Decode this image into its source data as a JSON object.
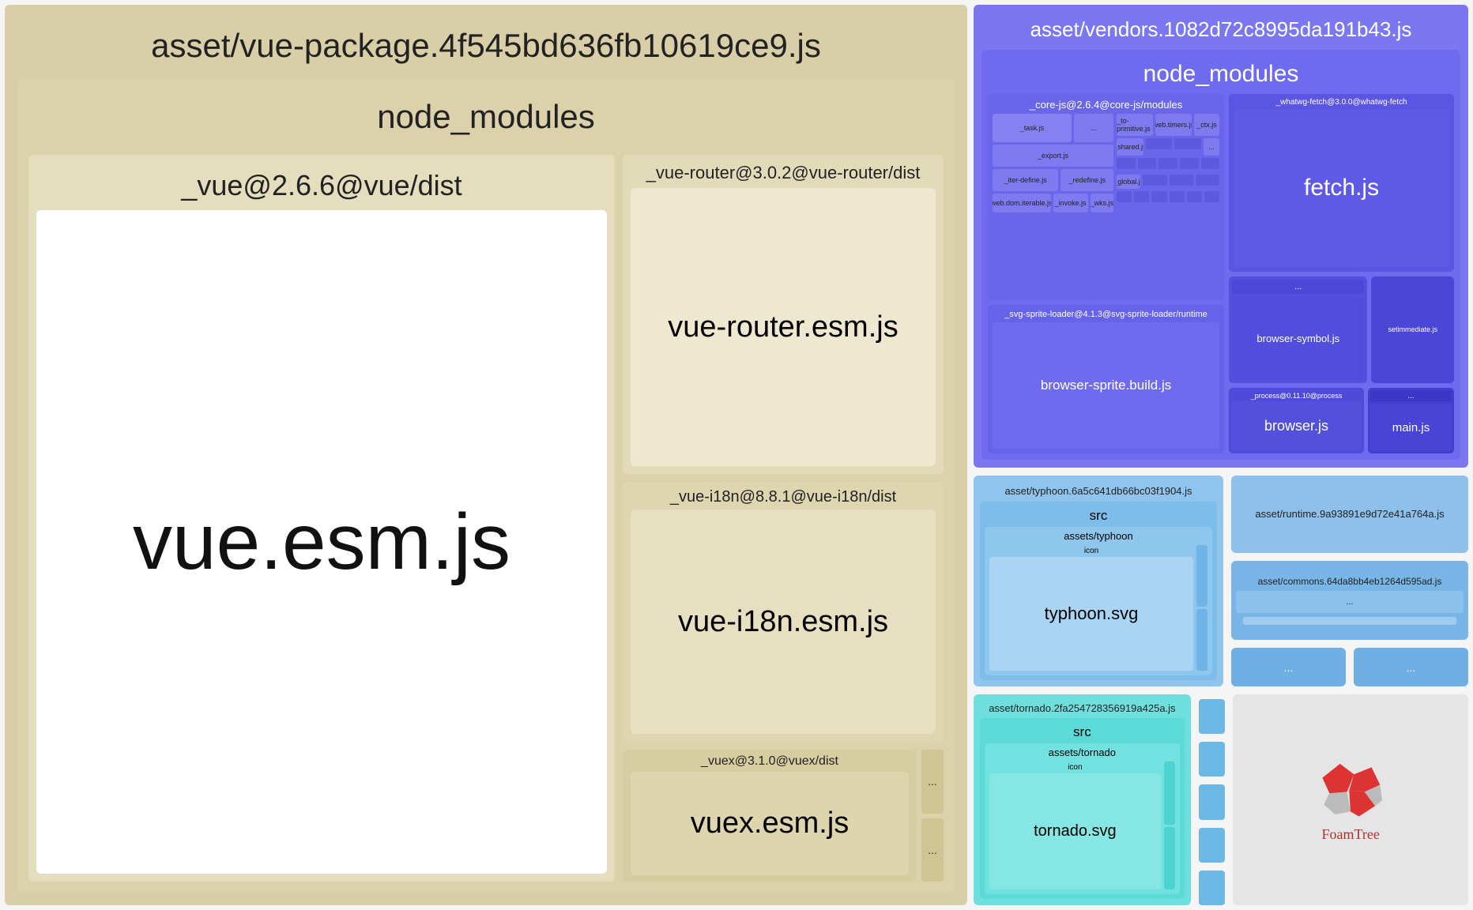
{
  "chart_data": {
    "type": "treemap",
    "title": "Webpack Bundle Analyzer",
    "nodes": [
      {
        "name": "asset/vue-package.4f545bd636fb10619ce9.js",
        "children": [
          {
            "name": "node_modules",
            "children": [
              {
                "name": "_vue@2.6.6@vue/dist",
                "children": [
                  {
                    "name": "vue.esm.js"
                  }
                ]
              },
              {
                "name": "_vue-router@3.0.2@vue-router/dist",
                "children": [
                  {
                    "name": "vue-router.esm.js"
                  }
                ]
              },
              {
                "name": "_vue-i18n@8.8.1@vue-i18n/dist",
                "children": [
                  {
                    "name": "vue-i18n.esm.js"
                  }
                ]
              },
              {
                "name": "_vuex@3.1.0@vuex/dist",
                "children": [
                  {
                    "name": "vuex.esm.js"
                  }
                ]
              }
            ]
          }
        ]
      },
      {
        "name": "asset/vendors.1082d72c8995da191b43.js",
        "children": [
          {
            "name": "node_modules",
            "children": [
              {
                "name": "_core-js@2.6.4@core-js/modules",
                "children": [
                  {
                    "name": "_task.js"
                  },
                  {
                    "name": "_export.js"
                  },
                  {
                    "name": "_iter-define.js"
                  },
                  {
                    "name": "_redefine.js"
                  },
                  {
                    "name": "web.dom.iterable.js"
                  },
                  {
                    "name": "_invoke.js"
                  },
                  {
                    "name": "_wks.js"
                  },
                  {
                    "name": "_global.js"
                  },
                  {
                    "name": "_to-primitive.js"
                  },
                  {
                    "name": "web.timers.js"
                  },
                  {
                    "name": "_ctx.js"
                  },
                  {
                    "name": "_shared.js"
                  }
                ]
              },
              {
                "name": "_svg-sprite-loader@4.1.3@svg-sprite-loader/runtime",
                "children": [
                  {
                    "name": "browser-sprite.build.js"
                  }
                ]
              },
              {
                "name": "_whatwg-fetch@3.0.0@whatwg-fetch",
                "children": [
                  {
                    "name": "fetch.js"
                  }
                ]
              },
              {
                "name": "browser-symbol.js"
              },
              {
                "name": "setimmediate.js"
              },
              {
                "name": "_process@0.11.10@process",
                "children": [
                  {
                    "name": "browser.js"
                  }
                ]
              },
              {
                "name": "main.js"
              }
            ]
          }
        ]
      },
      {
        "name": "asset/typhoon.6a5c641db66bc03f1904.js",
        "children": [
          {
            "name": "src",
            "children": [
              {
                "name": "assets/typhoon",
                "children": [
                  {
                    "name": "icon",
                    "children": [
                      {
                        "name": "typhoon.svg"
                      }
                    ]
                  }
                ]
              }
            ]
          }
        ]
      },
      {
        "name": "asset/runtime.9a93891e9d72e41a764a.js"
      },
      {
        "name": "asset/commons.64da8bb4eb1264d595ad.js"
      },
      {
        "name": "asset/tornado.2fa254728356919a425a.js",
        "children": [
          {
            "name": "src",
            "children": [
              {
                "name": "assets/tornado",
                "children": [
                  {
                    "name": "icon",
                    "children": [
                      {
                        "name": "tornado.svg"
                      }
                    ]
                  }
                ]
              }
            ]
          }
        ]
      }
    ]
  },
  "vuePkg": {
    "title": "asset/vue-package.4f545bd636fb10619ce9.js",
    "nm": "node_modules",
    "vueDist": "_vue@2.6.6@vue/dist",
    "vueEsm": "vue.esm.js",
    "routerDist": "_vue-router@3.0.2@vue-router/dist",
    "routerFile": "vue-router.esm.js",
    "i18nDist": "_vue-i18n@8.8.1@vue-i18n/dist",
    "i18nFile": "vue-i18n.esm.js",
    "vuexDist": "_vuex@3.1.0@vuex/dist",
    "vuexFile": "vuex.esm.js",
    "dots": "..."
  },
  "vendors": {
    "title": "asset/vendors.1082d72c8995da191b43.js",
    "nm": "node_modules",
    "corejs": "_core-js@2.6.4@core-js/modules",
    "cj": {
      "task": "_task.js",
      "export": "_export.js",
      "iterDef": "_iter-define.js",
      "redefine": "_redefine.js",
      "webdom": "web.dom.iterable.js",
      "invoke": "_invoke.js",
      "wks": "_wks.js",
      "global": "_global.js",
      "toprim": "_to-primitive.js",
      "timers": "web.timers.js",
      "ctx": "_ctx.js",
      "shared": "_shared.js",
      "dots": "..."
    },
    "svgloader": "_svg-sprite-loader@4.1.3@svg-sprite-loader/runtime",
    "browserSprite": "browser-sprite.build.js",
    "fetchDir": "_whatwg-fetch@3.0.0@whatwg-fetch",
    "fetch": "fetch.js",
    "browserSymbol": "browser-symbol.js",
    "setimmediate": "setimmediate.js",
    "processDir": "_process@0.11.10@process",
    "browserjs": "browser.js",
    "mainjs": "main.js",
    "dots": "..."
  },
  "typhoon": {
    "title": "asset/typhoon.6a5c641db66bc03f1904.js",
    "src": "src",
    "assets": "assets/typhoon",
    "icon": "icon",
    "svg": "typhoon.svg"
  },
  "runtime": {
    "title": "asset/runtime.9a93891e9d72e41a764a.js"
  },
  "commons": {
    "title": "asset/commons.64da8bb4eb1264d595ad.js",
    "dots": "..."
  },
  "small": {
    "dots": "..."
  },
  "tornado": {
    "title": "asset/tornado.2fa254728356919a425a.js",
    "src": "src",
    "assets": "assets/tornado",
    "icon": "icon",
    "svg": "tornado.svg"
  },
  "logo": {
    "name": "FoamTree"
  }
}
